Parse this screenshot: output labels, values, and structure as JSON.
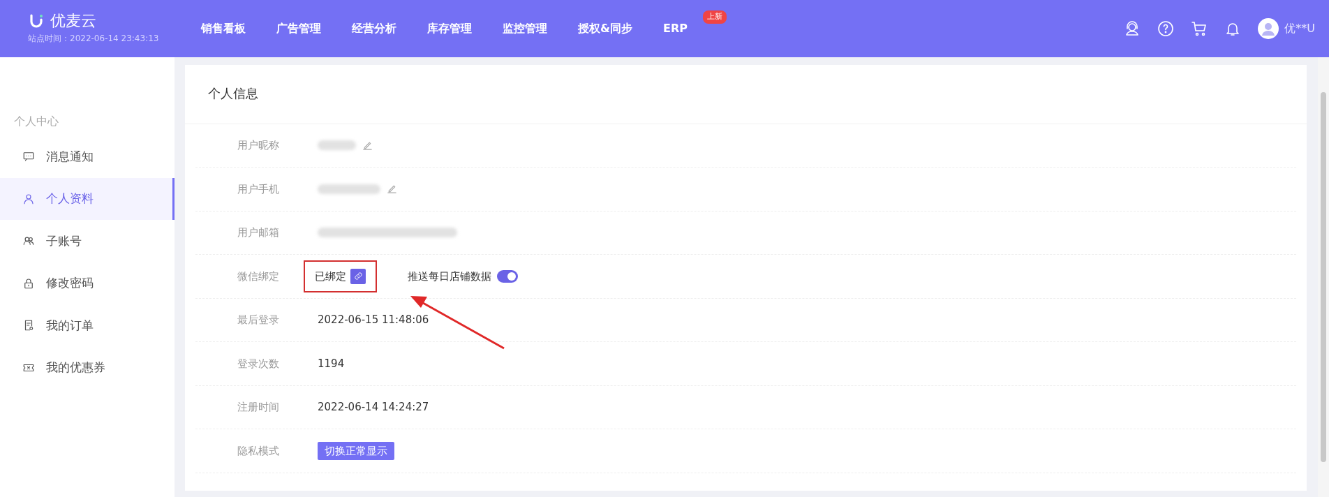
{
  "header": {
    "brand": "优麦云",
    "site_time": "站点时间：2022-06-14 23:43:13",
    "nav": [
      {
        "label": "销售看板"
      },
      {
        "label": "广告管理"
      },
      {
        "label": "经营分析"
      },
      {
        "label": "库存管理"
      },
      {
        "label": "监控管理"
      },
      {
        "label": "授权&同步"
      },
      {
        "label": "ERP",
        "badge": "上新"
      }
    ],
    "user": "优**U"
  },
  "sidebar": {
    "title": "个人中心",
    "items": [
      {
        "label": "消息通知",
        "selected": false
      },
      {
        "label": "个人资料",
        "selected": true
      },
      {
        "label": "子账号",
        "selected": false
      },
      {
        "label": "修改密码",
        "selected": false
      },
      {
        "label": "我的订单",
        "selected": false
      },
      {
        "label": "我的优惠券",
        "selected": false
      }
    ]
  },
  "panel": {
    "title": "个人信息",
    "rows": [
      {
        "label": "用户昵称",
        "kind": "blurred",
        "editable": true
      },
      {
        "label": "用户手机",
        "kind": "blurred",
        "editable": true
      },
      {
        "label": "用户邮箱",
        "kind": "blurred",
        "editable": false
      },
      {
        "label": "微信绑定",
        "kind": "binding",
        "value": "已绑定",
        "highlighted": true,
        "toggle_label": "推送每日店铺数据",
        "on": true
      },
      {
        "label": "最后登录",
        "kind": "text",
        "value": "2022-06-15 11:48:06"
      },
      {
        "label": "登录次数",
        "kind": "text",
        "value": "1194"
      },
      {
        "label": "注册时间",
        "kind": "text",
        "value": "2022-06-14 14:24:27"
      },
      {
        "label": "隐私模式",
        "kind": "button",
        "value": "切换正常显示"
      }
    ]
  }
}
